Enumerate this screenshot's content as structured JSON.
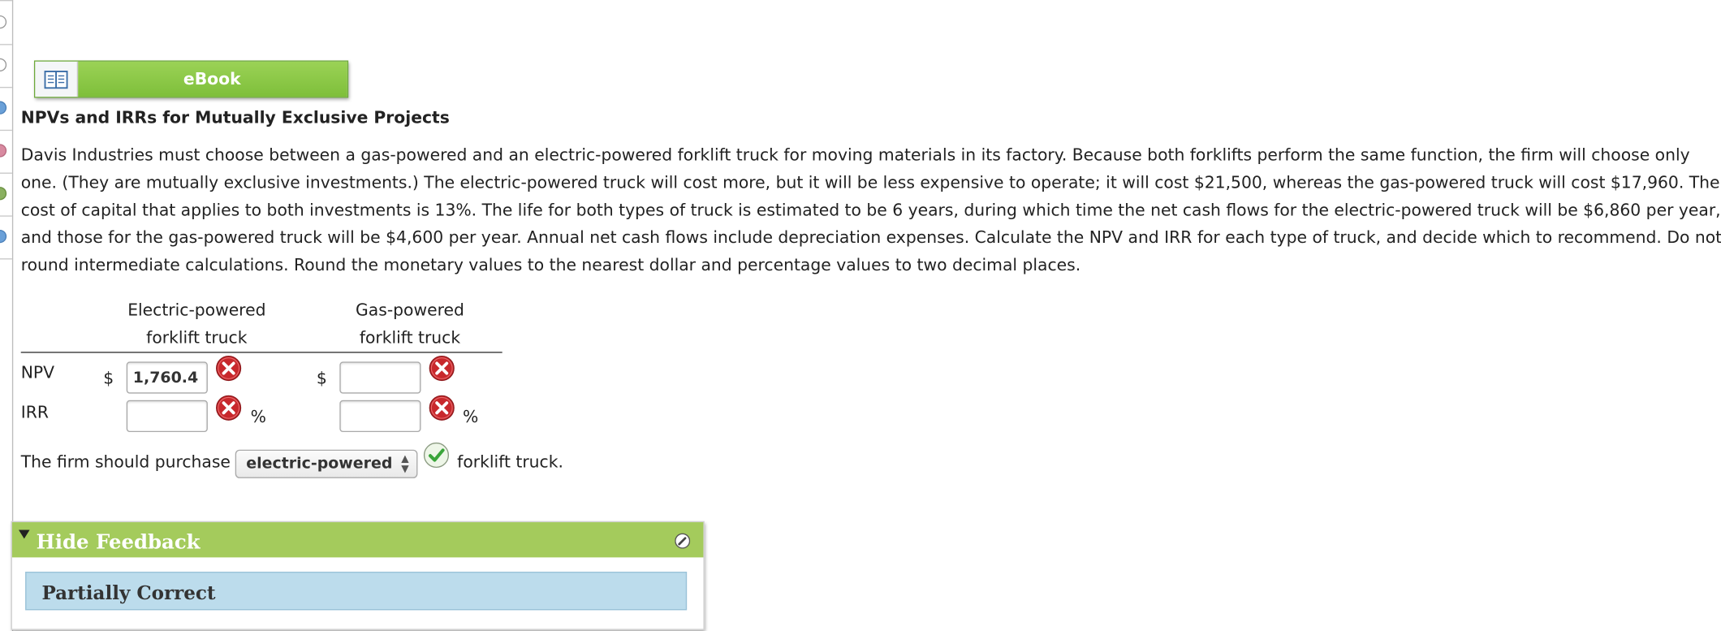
{
  "ebook": {
    "label": "eBook",
    "icon": "book-icon"
  },
  "problem": {
    "title": "NPVs and IRRs for Mutually Exclusive Projects",
    "lines": [
      "Davis Industries must choose between a gas-powered and an electric-powered forklift truck for moving materials in its factory. Because both forklifts perform the same function, the firm will choose only",
      "one. (They are mutually exclusive investments.) The electric-powered truck will cost more, but it will be less expensive to operate; it will cost $21,500, whereas the gas-powered truck will cost $17,960. The",
      "cost of capital that applies to both investments is 13%. The life for both types of truck is estimated to be 6 years, during which time the net cash flows for the electric-powered truck will be $6,860 per year,",
      "and those for the gas-powered truck will be $4,600 per year. Annual net cash flows include depreciation expenses. Calculate the NPV and IRR for each type of truck, and decide which to recommend. Do not",
      "round intermediate calculations. Round the monetary values to the nearest dollar and percentage values to two decimal places."
    ]
  },
  "table": {
    "columns": [
      {
        "line1": "Electric-powered",
        "line2": "forklift truck"
      },
      {
        "line1": "Gas-powered",
        "line2": "forklift truck"
      }
    ],
    "currency_symbol": "$",
    "percent_symbol": "%",
    "rows": [
      {
        "label": "NPV",
        "electric_value": "1,760.4",
        "gas_value": "",
        "electric_status": "incorrect",
        "gas_status": "incorrect"
      },
      {
        "label": "IRR",
        "electric_value": "",
        "gas_value": "",
        "electric_status": "incorrect",
        "gas_status": "incorrect"
      }
    ]
  },
  "recommendation": {
    "prefix": "The firm should purchase",
    "selected": "electric-powered",
    "suffix": "forklift truck.",
    "status": "correct"
  },
  "feedback": {
    "toggle_label": "Hide Feedback",
    "status_text": "Partially Correct"
  },
  "colors": {
    "ebook_green": "#8bc84a",
    "feedback_green": "#a4cb5c",
    "status_blue": "#bcdcec",
    "incorrect_red": "#c8282c",
    "correct_green": "#3aa53a"
  }
}
